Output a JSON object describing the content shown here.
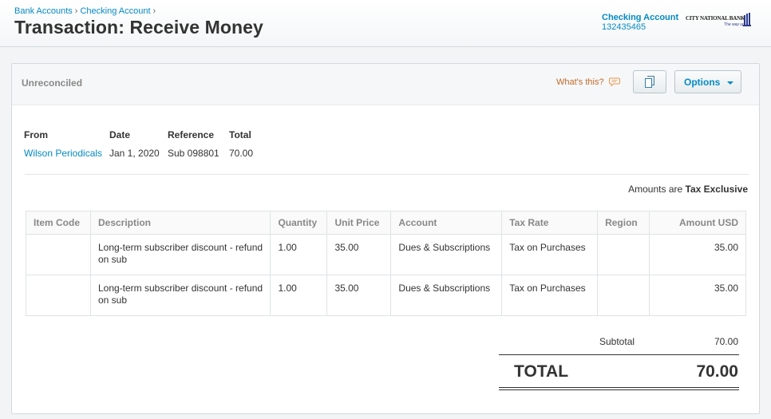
{
  "header": {
    "breadcrumb": [
      "Bank Accounts",
      "Checking Account"
    ],
    "breadcrumb_separator": "›",
    "title": "Transaction: Receive Money",
    "account_name": "Checking Account",
    "account_number": "132435465",
    "bank_logo_text": "CityNationalBank",
    "bank_logo_tagline": "The way up."
  },
  "panel": {
    "status": "Unreconciled",
    "whats_this": "What's this?",
    "options_label": "Options"
  },
  "details": {
    "from_label": "From",
    "from_value": "Wilson Periodicals",
    "date_label": "Date",
    "date_value": "Jan 1, 2020",
    "reference_label": "Reference",
    "reference_value": "Sub 098801",
    "total_label": "Total",
    "total_value": "70.00"
  },
  "tax_note": {
    "prefix": "Amounts are ",
    "mode": "Tax Exclusive"
  },
  "table": {
    "columns": [
      "Item Code",
      "Description",
      "Quantity",
      "Unit Price",
      "Account",
      "Tax Rate",
      "Region",
      "Amount USD"
    ],
    "rows": [
      {
        "item_code": "",
        "description": "Long-term subscriber discount - refund on sub",
        "quantity": "1.00",
        "unit_price": "35.00",
        "account": "Dues & Subscriptions",
        "tax_rate": "Tax on Purchases",
        "region": "",
        "amount": "35.00"
      },
      {
        "item_code": "",
        "description": "Long-term subscriber discount - refund on sub",
        "quantity": "1.00",
        "unit_price": "35.00",
        "account": "Dues & Subscriptions",
        "tax_rate": "Tax on Purchases",
        "region": "",
        "amount": "35.00"
      }
    ]
  },
  "totals": {
    "subtotal_label": "Subtotal",
    "subtotal_value": "70.00",
    "total_label": "TOTAL",
    "total_value": "70.00"
  },
  "colors": {
    "link": "#048ac4",
    "whats_this": "#c16a2b"
  },
  "icons": {
    "whats_this": "speech-bubble-icon",
    "copy": "copy-document-icon",
    "options": "chevron-down-icon"
  }
}
